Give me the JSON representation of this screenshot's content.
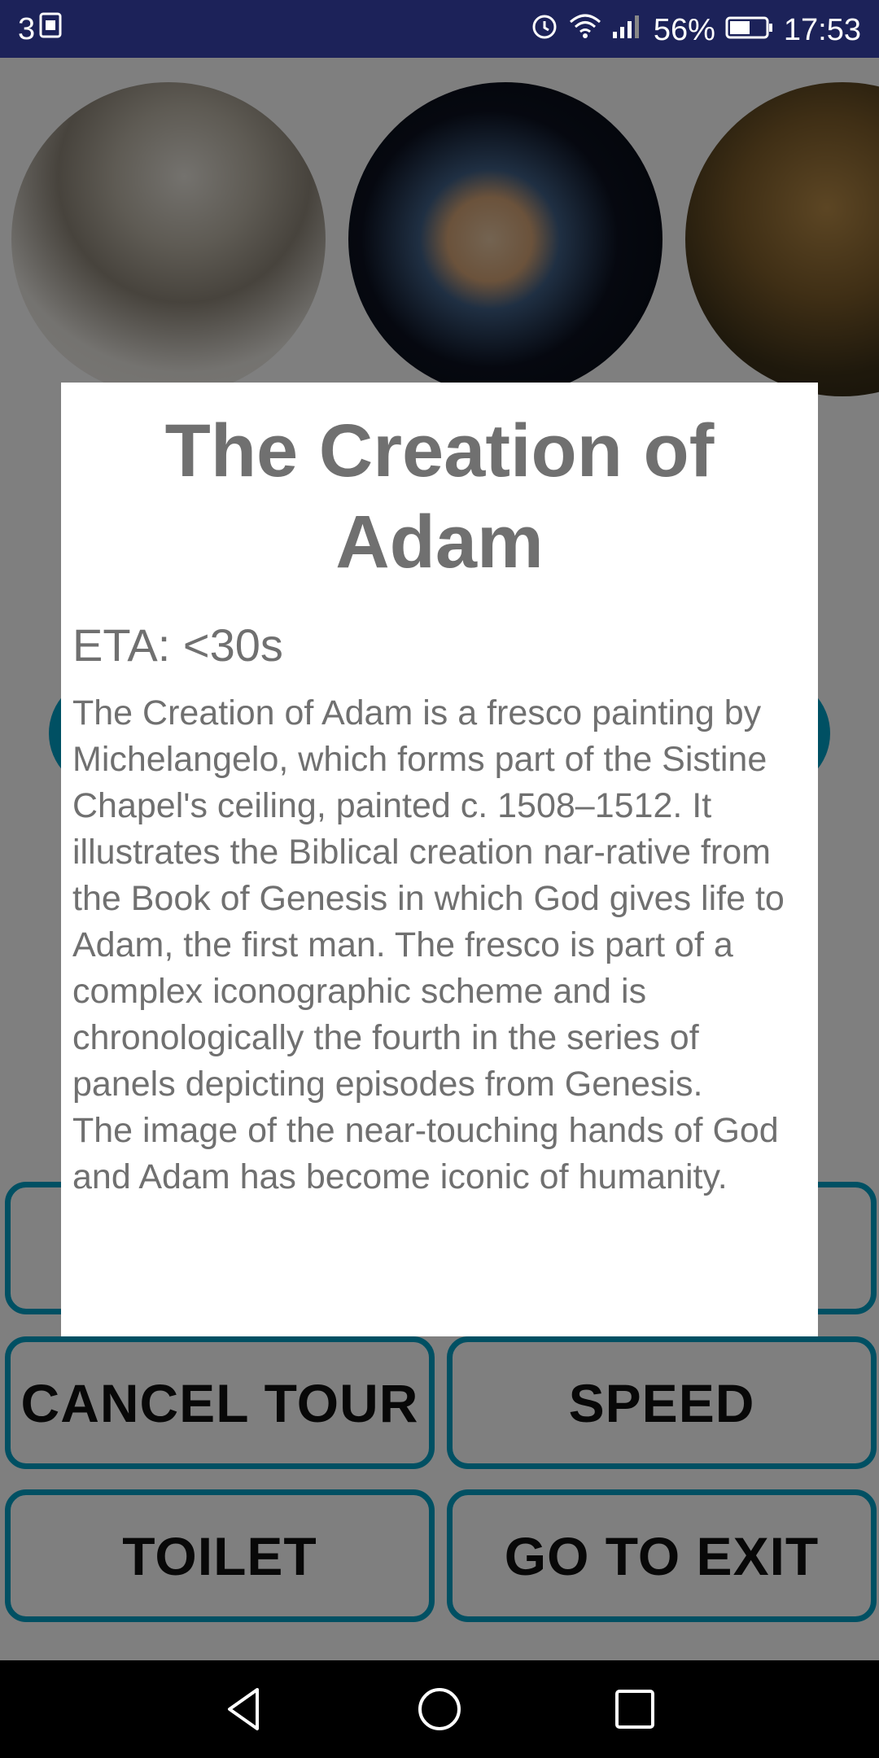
{
  "status_bar": {
    "notification_count": "3",
    "battery_percent": "56%",
    "time": "17:53",
    "icons": [
      "sim-card-icon",
      "alarm-icon",
      "wifi-icon",
      "signal-icon",
      "battery-icon"
    ]
  },
  "artworks": [
    {
      "name": "david-statue"
    },
    {
      "name": "girl-with-pearl-earring"
    },
    {
      "name": "mona-lisa"
    }
  ],
  "buttons": {
    "cancel_tour": "CANCEL TOUR",
    "speed": "SPEED",
    "toilet": "TOILET",
    "go_to_exit": "GO TO EXIT"
  },
  "dialog": {
    "title": "The Creation of Adam",
    "eta": "ETA: <30s",
    "description": "The Creation of Adam is a fresco painting by Michelangelo, which forms part of the Sistine Chapel's ceiling, painted c. 1508–1512. It illustrates the Biblical creation nar-rative from the Book of Genesis in which God gives life to Adam, the first man. The fresco is part of a complex iconographic scheme and is chronologically the fourth in the series of panels depicting episodes from Genesis.\nThe image of the near-touching hands of God and Adam has become iconic of humanity."
  },
  "colors": {
    "status_bar": "#1c2259",
    "accent": "#00a0c6",
    "dialog_text": "#707070"
  }
}
